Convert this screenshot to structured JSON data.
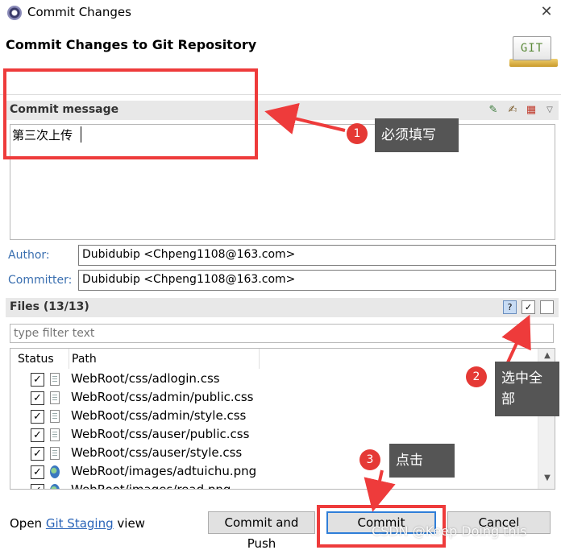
{
  "window": {
    "title": "Commit Changes",
    "close_glyph": "✕",
    "app_icon": "eclipse-icon"
  },
  "header": {
    "title": "Commit Changes to Git Repository",
    "logo_text": "GIT"
  },
  "commit_message": {
    "section_label": "Commit message",
    "value": "第三次上传",
    "toolbar_icons": [
      "spell-check-icon",
      "edit-icon",
      "add-signed-off-icon",
      "menu-chevron-icon"
    ]
  },
  "author": {
    "label": "Author:",
    "value": "Dubidubip <Chpeng1108@163.com>"
  },
  "committer": {
    "label": "Committer:",
    "value": "Dubidubip <Chpeng1108@163.com>"
  },
  "files": {
    "section_label": "Files (13/13)",
    "filter_placeholder": "type filter text",
    "columns": [
      "Status",
      "Path"
    ],
    "rows": [
      {
        "checked": true,
        "icon": "file-icon",
        "path": "WebRoot/css/adlogin.css"
      },
      {
        "checked": true,
        "icon": "file-icon",
        "path": "WebRoot/css/admin/public.css"
      },
      {
        "checked": true,
        "icon": "file-icon",
        "path": "WebRoot/css/admin/style.css"
      },
      {
        "checked": true,
        "icon": "file-icon",
        "path": "WebRoot/css/auser/public.css"
      },
      {
        "checked": true,
        "icon": "file-icon",
        "path": "WebRoot/css/auser/style.css"
      },
      {
        "checked": true,
        "icon": "image-file-icon",
        "path": "WebRoot/images/adtuichu.png"
      },
      {
        "checked": true,
        "icon": "image-file-icon",
        "path": "WebRoot/images/read.png"
      }
    ]
  },
  "footer": {
    "open_prefix": "Open",
    "staging_link": "Git Staging",
    "open_suffix": "view",
    "commit_and_push": "Commit and Push",
    "commit": "Commit",
    "cancel": "Cancel"
  },
  "annotations": {
    "step1_number": "1",
    "step1_text": "必须填写",
    "step2_number": "2",
    "step2_text": "选中全部",
    "step3_number": "3",
    "step3_text": "点击",
    "accent_color": "#ee3b3b"
  },
  "watermark": "CSDN @Keep Doing this"
}
